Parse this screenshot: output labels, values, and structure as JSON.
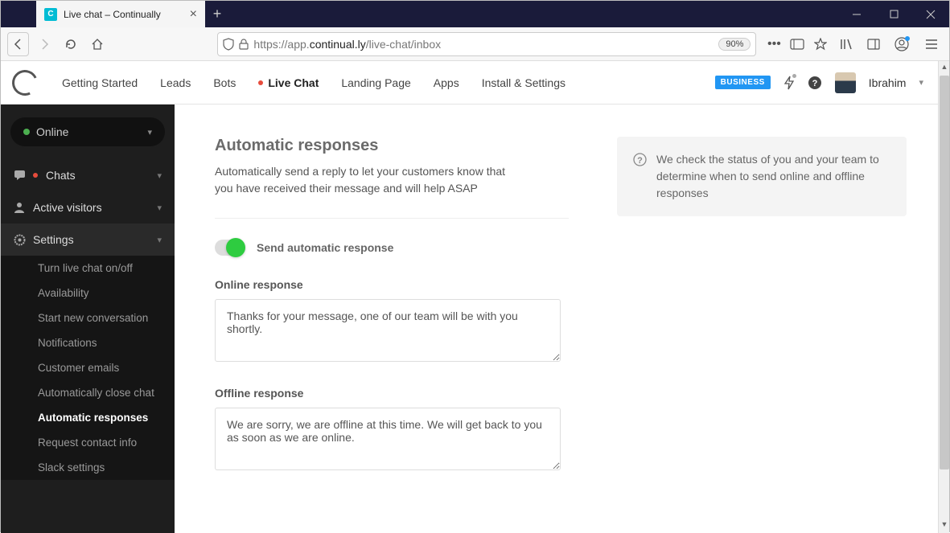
{
  "browser": {
    "tab_title": "Live chat – Continually",
    "url_prefix": "https://app.",
    "url_domain": "continual.ly",
    "url_path": "/live-chat/inbox",
    "zoom": "90%"
  },
  "topnav": {
    "items": [
      "Getting Started",
      "Leads",
      "Bots",
      "Live Chat",
      "Landing Page",
      "Apps",
      "Install & Settings"
    ],
    "active_index": 3,
    "badge": "BUSINESS",
    "username": "Ibrahim"
  },
  "sidebar": {
    "status": "Online",
    "sections": {
      "chats": "Chats",
      "active_visitors": "Active visitors",
      "settings": "Settings"
    },
    "settings_items": [
      "Turn live chat on/off",
      "Availability",
      "Start new conversation",
      "Notifications",
      "Customer emails",
      "Automatically close chat",
      "Automatic responses",
      "Request contact info",
      "Slack settings"
    ],
    "settings_active_index": 6
  },
  "page": {
    "title": "Automatic responses",
    "description": "Automatically send a reply to let your customers know that you have received their message and will help ASAP",
    "toggle_label": "Send automatic response",
    "online_label": "Online response",
    "online_value": "Thanks for your message, one of our team will be with you shortly.",
    "offline_label": "Offline response",
    "offline_value": "We are sorry, we are offline at this time. We will get back to you as soon as we are online.",
    "info_text": "We check the status of you and your team to determine when to send online and offline responses"
  }
}
